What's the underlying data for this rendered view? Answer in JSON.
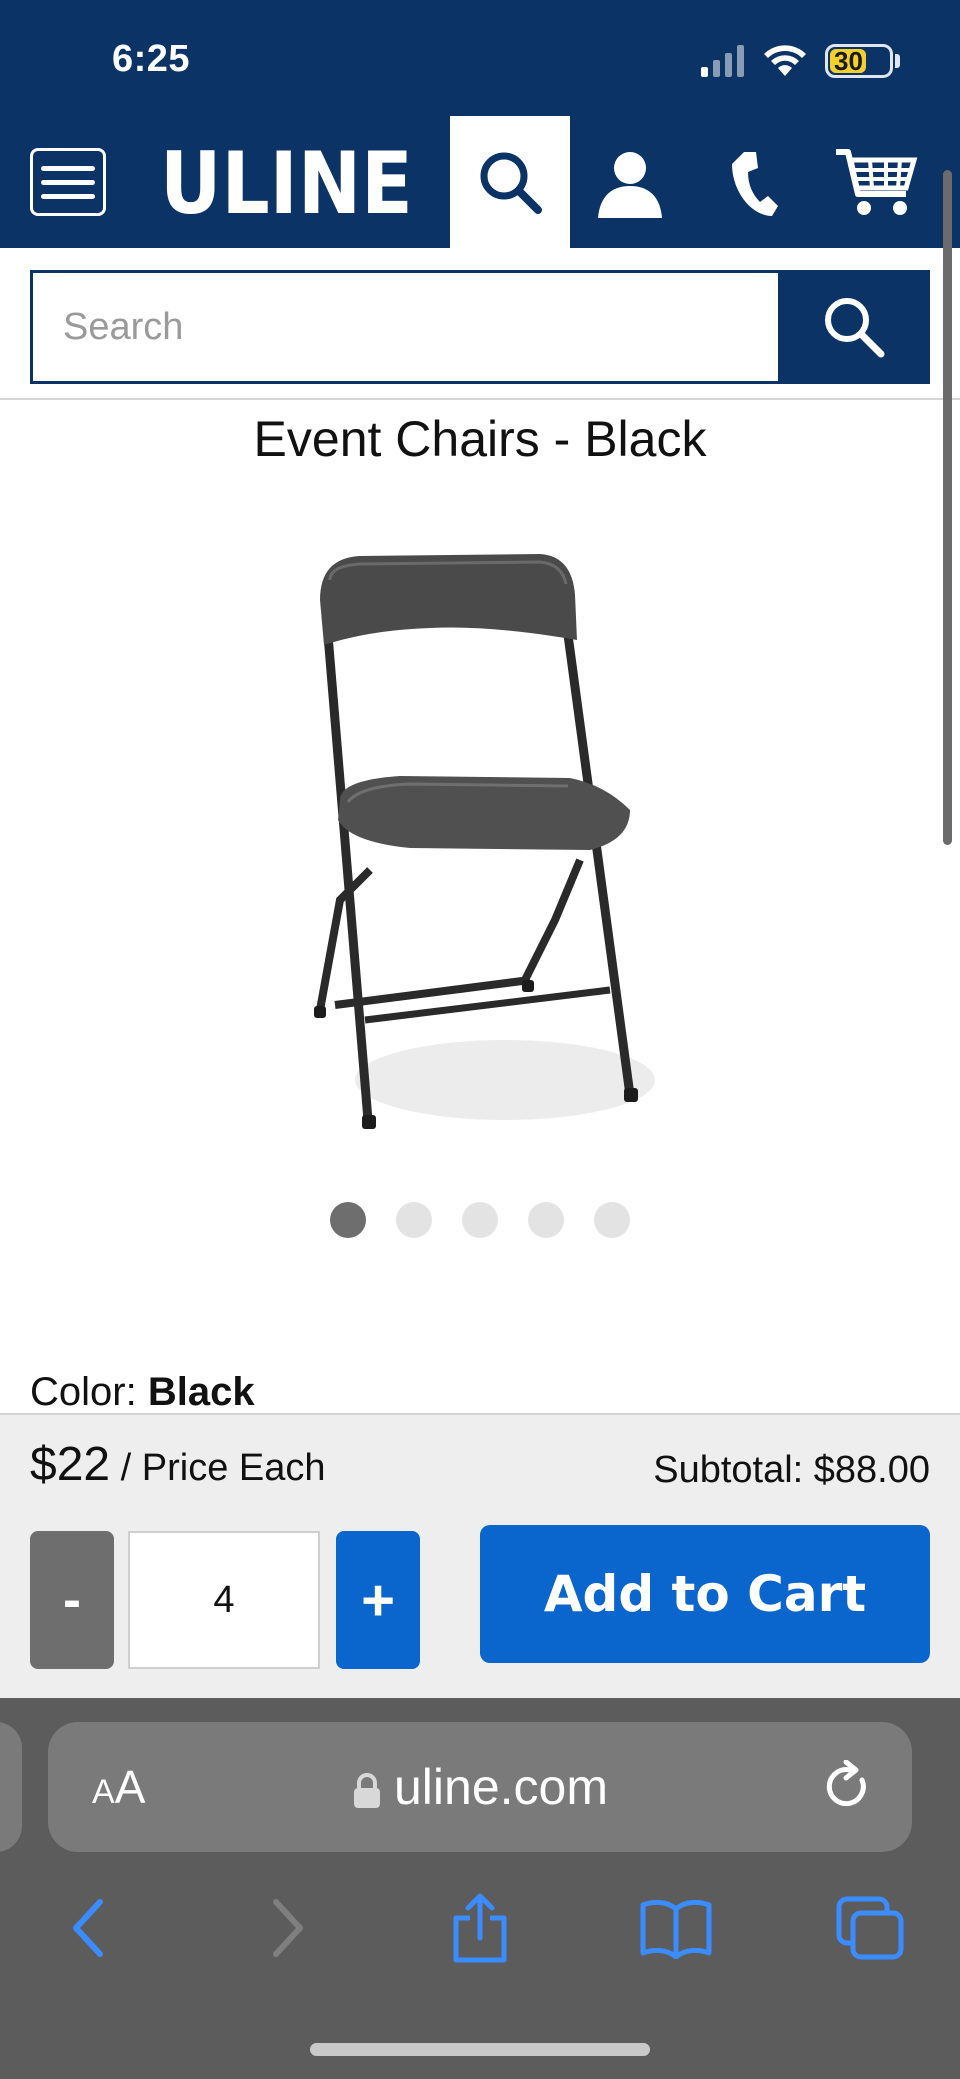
{
  "status_bar": {
    "time": "6:25",
    "battery": "30"
  },
  "header": {
    "logo": "ULINE"
  },
  "search": {
    "placeholder": "Search"
  },
  "product": {
    "title": "Event Chairs - Black",
    "image_dots": 5,
    "active_dot": 1,
    "color_label": "Color:",
    "color_value": "Black"
  },
  "cart": {
    "price": "$22",
    "price_unit": " / Price Each",
    "subtotal": "Subtotal: $88.00",
    "minus_label": "-",
    "quantity": "4",
    "plus_label": "+",
    "add_label": "Add to Cart"
  },
  "browser": {
    "aa_small": "A",
    "aa_large": "A",
    "url": "uline.com"
  },
  "colors": {
    "brand_navy": "#0b3366",
    "action_blue": "#0a66cc",
    "safari_link_blue": "#3b8cff"
  }
}
